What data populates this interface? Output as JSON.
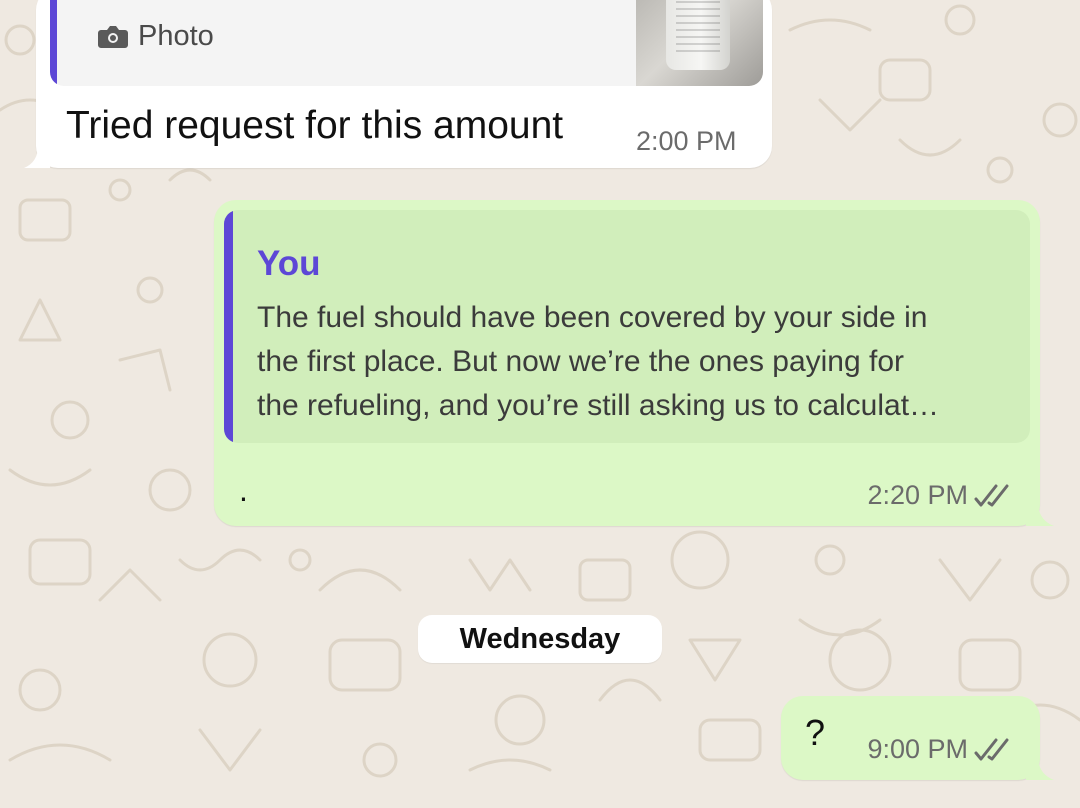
{
  "chat": {
    "incoming": {
      "quote_label": "Photo",
      "text": "Tried request for this amount",
      "time": "2:00 PM"
    },
    "outgoing_reply": {
      "quote_author": "You",
      "quote_lines": [
        "The fuel should have been covered by your side in",
        "the first place. But now we’re the ones paying for",
        "the refueling, and you’re still asking us to calculat…"
      ],
      "text": ".",
      "time": "2:20 PM"
    },
    "date_separator": "Wednesday",
    "outgoing_latest": {
      "text": "?",
      "time": "9:00 PM"
    }
  },
  "colors": {
    "wallpaper": "#efe9e1",
    "incoming_bubble": "#ffffff",
    "outgoing_bubble": "#dcf8c6",
    "reply_accent": "#5d47d6"
  }
}
